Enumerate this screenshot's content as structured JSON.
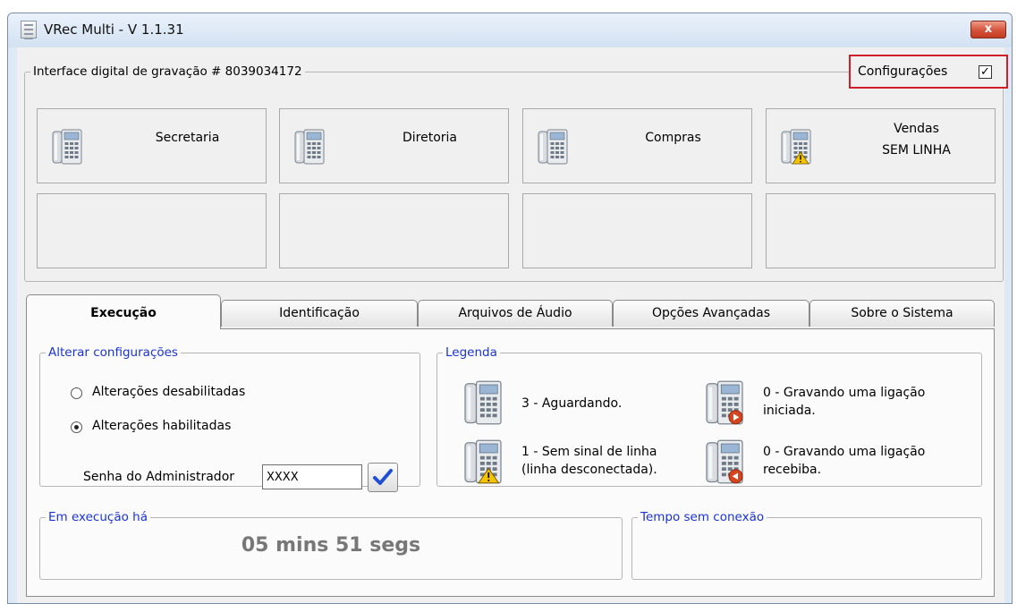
{
  "window": {
    "title": "VRec Multi - V 1.1.31",
    "close_glyph": "x"
  },
  "interface": {
    "label": "Interface digital de gravação # 8039034172",
    "config_label": "Configurações",
    "config_checked": true,
    "config_check_glyph": "✓"
  },
  "extensions": [
    {
      "name": "Secretaria",
      "status": "",
      "icon": "desk-phone-icon"
    },
    {
      "name": "Diretoria",
      "status": "",
      "icon": "desk-phone-icon"
    },
    {
      "name": "Compras",
      "status": "",
      "icon": "desk-phone-icon"
    },
    {
      "name": "Vendas",
      "status": "SEM LINHA",
      "icon": "desk-phone-warning-icon"
    }
  ],
  "tabs": [
    {
      "label": "Execução",
      "active": true
    },
    {
      "label": "Identificação",
      "active": false
    },
    {
      "label": "Arquivos de Áudio",
      "active": false
    },
    {
      "label": "Opções Avançadas",
      "active": false
    },
    {
      "label": "Sobre o Sistema",
      "active": false
    }
  ],
  "alterar": {
    "title": "Alterar configurações",
    "option_disabled": "Alterações desabilitadas",
    "option_enabled": "Alterações habilitadas",
    "selected": "Alterações habilitadas",
    "password_label": "Senha do Administrador",
    "password_value": "XXXX",
    "confirm_glyph": "✔"
  },
  "legenda": {
    "title": "Legenda",
    "items": [
      {
        "line1": "3 - Aguardando.",
        "line2": "",
        "icon": "desk-phone-icon"
      },
      {
        "line1": "0 - Gravando uma ligação",
        "line2": "iniciada.",
        "icon": "desk-phone-outgoing-icon"
      },
      {
        "line1": "1 - Sem sinal de linha",
        "line2": "(linha desconectada).",
        "icon": "desk-phone-warning-icon"
      },
      {
        "line1": "0 - Gravando uma ligação",
        "line2": "recebiba.",
        "icon": "desk-phone-incoming-icon"
      }
    ]
  },
  "execucao": {
    "title": "Em execução há",
    "value": "05 mins 51 segs"
  },
  "sem_conexao": {
    "title": "Tempo sem conexão",
    "value": ""
  },
  "colors": {
    "group_title_blue": "#1a33d4",
    "highlight_red": "#d11f2a",
    "timer_gray": "#777777"
  }
}
